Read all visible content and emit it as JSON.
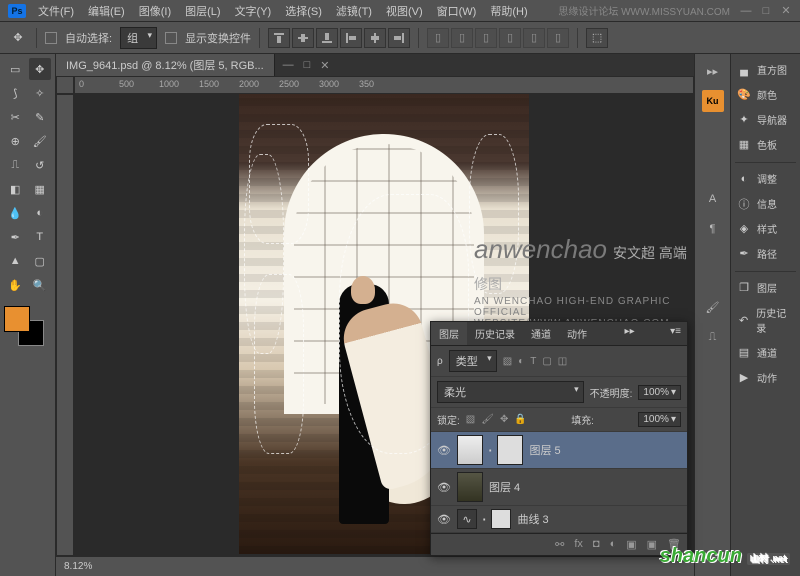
{
  "app": {
    "logo_text": "Ps",
    "right_text": "思缘设计论坛 WWW.MISSYUAN.COM"
  },
  "menu": {
    "file": "文件(F)",
    "edit": "编辑(E)",
    "image": "图像(I)",
    "layer": "图层(L)",
    "type": "文字(Y)",
    "select": "选择(S)",
    "filter": "滤镜(T)",
    "view": "视图(V)",
    "window": "窗口(W)",
    "help": "帮助(H)"
  },
  "options_bar": {
    "auto_select": "自动选择:",
    "group": "组",
    "show_transform": "显示变换控件"
  },
  "document": {
    "tab_title": "IMG_9641.psd @ 8.12% (图层 5, RGB...",
    "zoom": "8.12%",
    "ruler_marks": [
      "0",
      "500",
      "1000",
      "1500",
      "2000",
      "2500",
      "3000",
      "350"
    ]
  },
  "watermark": {
    "main": "anwenchao",
    "cn": "安文超 高端修图",
    "sub": "AN WENCHAO HIGH-END GRAPHIC OFFICIAL WEBSITE/WWW.ANWENCHAO.COM"
  },
  "right_panel_groups": {
    "g1": [
      "直方图",
      "颜色",
      "导航器",
      "色板"
    ],
    "g2": [
      "调整",
      "信息",
      "样式",
      "路径"
    ],
    "g3": [
      "图层",
      "历史记录",
      "通道",
      "动作"
    ]
  },
  "layers_panel": {
    "tabs": [
      "图层",
      "历史记录",
      "通道",
      "动作"
    ],
    "kind_label": "类型",
    "blend_mode": "柔光",
    "opacity_label": "不透明度:",
    "opacity_value": "100%",
    "lock_label": "锁定:",
    "fill_label": "填充:",
    "fill_value": "100%",
    "layers": [
      {
        "name": "图层 5",
        "selected": true,
        "thumb": "light",
        "mask": true
      },
      {
        "name": "图层 4",
        "selected": false,
        "thumb": "dark",
        "mask": false
      },
      {
        "name": "曲线 3",
        "selected": false,
        "thumb": "adj",
        "mask": true
      }
    ]
  },
  "footer_logo": {
    "text": "shancun",
    "tag": "山村 .net"
  }
}
